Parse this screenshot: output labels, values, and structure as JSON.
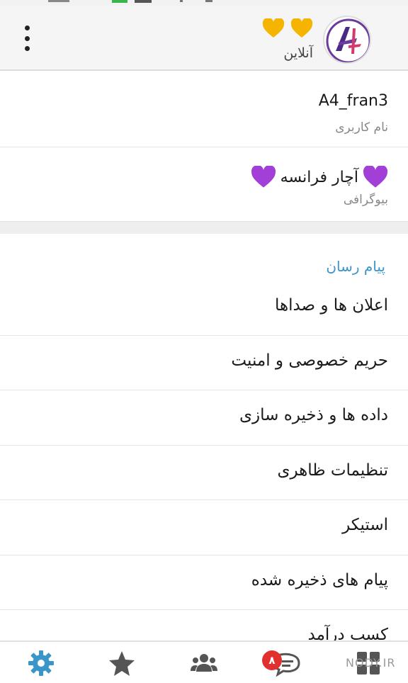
{
  "colors": {
    "accent": "#3a95c9",
    "heart_gold": "#f5b400",
    "heart_purple": "#a23fd6",
    "badge_red": "#e0312f",
    "settings_active": "#3a95c9"
  },
  "header": {
    "status": "آنلاین",
    "menu_icon": "kebab-menu-icon",
    "avatar_icon": "a4-logo-avatar"
  },
  "profile": {
    "username_value": "A4_fran3",
    "username_label": "نام کاربری",
    "bio_value": "آچار فرانسه",
    "bio_label": "بیوگرافی"
  },
  "settings": {
    "section_title": "پیام رسان",
    "items": [
      {
        "label": "اعلان ها و صداها"
      },
      {
        "label": "حریم خصوصی و امنیت"
      },
      {
        "label": "داده ها و ذخیره سازی"
      },
      {
        "label": "تنظیمات ظاهری"
      },
      {
        "label": "استیکر"
      },
      {
        "label": "پیام های ذخیره شده"
      },
      {
        "label": "کسب درآمد"
      }
    ]
  },
  "bottom_nav": {
    "chats_badge": "۸",
    "icons": [
      "settings-gear-icon",
      "star-icon",
      "contacts-group-icon",
      "chat-bubbles-icon",
      "grid-apps-icon"
    ]
  },
  "watermark": {
    "text": "NODY.IR"
  }
}
